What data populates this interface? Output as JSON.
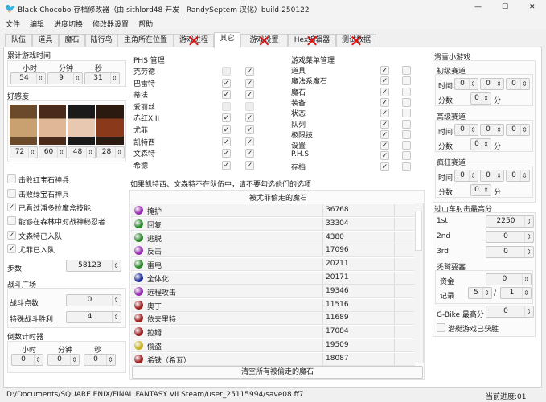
{
  "window": {
    "title": "Black Chocobo 存档修改器（由 sithlord48 开发 | RandySeptem 汉化）build-250122",
    "controls": [
      "—",
      "☐",
      "✕"
    ]
  },
  "menu": [
    "文件",
    "编辑",
    "进度切换",
    "修改器设置",
    "帮助"
  ],
  "tabs": [
    {
      "label": "队伍"
    },
    {
      "label": "道具"
    },
    {
      "label": "魔石"
    },
    {
      "label": "陆行鸟"
    },
    {
      "label": "主角所在位置"
    },
    {
      "label": "游戏进程",
      "crossed": true
    },
    {
      "label": "其它",
      "selected": true
    },
    {
      "label": "游戏设置",
      "crossed": true
    },
    {
      "label": "Hex编辑器",
      "crossed": true
    },
    {
      "label": "测试数据",
      "crossed": true
    }
  ],
  "left": {
    "playtime": {
      "title": "累计游戏时间",
      "labels": [
        "小时",
        "分钟",
        "秒"
      ],
      "values": [
        "54",
        "9",
        "31"
      ]
    },
    "love": {
      "title": "好感度",
      "values": [
        "72",
        "60",
        "48",
        "28"
      ]
    },
    "flags": [
      {
        "label": "击败红宝石神兵",
        "checked": false
      },
      {
        "label": "击败绿宝石神兵",
        "checked": false
      },
      {
        "label": "已看过潘多拉魔盒技能",
        "checked": true
      },
      {
        "label": "能够在森林中对战神秘忍者",
        "checked": false
      },
      {
        "label": "文森特已入队",
        "checked": true
      },
      {
        "label": "尤菲已入队",
        "checked": true
      }
    ],
    "steps": {
      "label": "步数",
      "value": "58123"
    },
    "battle_square": {
      "title": "战斗广场",
      "points_label": "战斗点数",
      "points": "0",
      "special_label": "特殊战斗胜利",
      "special": "4"
    },
    "countdown": {
      "title": "倒数计时器",
      "labels": [
        "小时",
        "分钟",
        "秒"
      ],
      "values": [
        "0",
        "0",
        "0"
      ]
    }
  },
  "phs": {
    "title": "PHS 管理",
    "rows": [
      {
        "name": "克劳德",
        "a": false,
        "a_disabled": true,
        "b": true
      },
      {
        "name": "巴雷特",
        "a": true,
        "b": true
      },
      {
        "name": "蒂法",
        "a": true,
        "b": true
      },
      {
        "name": "爱丽丝",
        "a": false,
        "a_disabled": true,
        "b": false,
        "b_disabled": true
      },
      {
        "name": "赤红XIII",
        "a": true,
        "b": true
      },
      {
        "name": "尤菲",
        "a": true,
        "b": true
      },
      {
        "name": "凯特西",
        "a": true,
        "b": true
      },
      {
        "name": "文森特",
        "a": true,
        "b": true
      },
      {
        "name": "希德",
        "a": true,
        "b": true
      }
    ]
  },
  "game_menu": {
    "title": "游戏菜单管理",
    "rows": [
      {
        "name": "道具",
        "a": true,
        "b": false
      },
      {
        "name": "魔法系魔石",
        "a": true,
        "b": false
      },
      {
        "name": "魔石",
        "a": true,
        "b": false
      },
      {
        "name": "装备",
        "a": true,
        "b": false
      },
      {
        "name": "状态",
        "a": true,
        "b": false
      },
      {
        "name": "队列",
        "a": true,
        "b": false
      },
      {
        "name": "极限技",
        "a": true,
        "b": false
      },
      {
        "name": "设置",
        "a": true,
        "b": false
      },
      {
        "name": "P.H.S",
        "a": true,
        "b": false
      },
      {
        "name": "存档",
        "a": true,
        "b": false
      }
    ]
  },
  "note": "如果凯特西、文森特不在队伍中，请不要勾选他们的选项",
  "stolen": {
    "title": "被尤菲偷走的魔石",
    "clear_label": "清空所有被偷走的魔石",
    "rows": [
      {
        "name": "掩护",
        "value": "36768",
        "color": "#9a2db5"
      },
      {
        "name": "回复",
        "value": "33304",
        "color": "#2a8a2a"
      },
      {
        "name": "逃脱",
        "value": "4380",
        "color": "#2a8a2a"
      },
      {
        "name": "反击",
        "value": "17096",
        "color": "#9a2db5"
      },
      {
        "name": "雷电",
        "value": "20211",
        "color": "#2a8a2a"
      },
      {
        "name": "全体化",
        "value": "20171",
        "color": "#1c2a9a"
      },
      {
        "name": "远程攻击",
        "value": "19346",
        "color": "#9a2db5"
      },
      {
        "name": "奥丁",
        "value": "11516",
        "color": "#a02020"
      },
      {
        "name": "依夫里特",
        "value": "11689",
        "color": "#a02020"
      },
      {
        "name": "拉姆",
        "value": "17084",
        "color": "#a02020"
      },
      {
        "name": "偷盗",
        "value": "19509",
        "color": "#c9b020"
      },
      {
        "name": "希铁（希瓦）",
        "value": "18087",
        "color": "#a02020"
      }
    ]
  },
  "right": {
    "snowboard": {
      "title": "滑雪小游戏",
      "time_label": "时间:",
      "score_label": "分数:",
      "unit": "分",
      "courses": [
        {
          "title": "初级赛道",
          "time": [
            "0",
            "0",
            "0"
          ],
          "score": "0"
        },
        {
          "title": "高级赛道",
          "time": [
            "0",
            "0",
            "0"
          ],
          "score": "0"
        },
        {
          "title": "疯狂赛道",
          "time": [
            "0",
            "0",
            "0"
          ],
          "score": "0"
        }
      ]
    },
    "coaster": {
      "title": "过山车射击最高分",
      "scores": [
        {
          "label": "1st",
          "value": "2250"
        },
        {
          "label": "2nd",
          "value": "0"
        },
        {
          "label": "3rd",
          "value": "0"
        }
      ]
    },
    "fort": {
      "title": "秃鹫要塞",
      "funds_label": "资金",
      "funds": "0",
      "record_label": "记录",
      "record_a": "5",
      "sep": "/",
      "record_b": "1"
    },
    "gbike": {
      "label": "G-Bike 最高分",
      "value": "0"
    },
    "sub": {
      "label": "潜艇游戏已获胜",
      "checked": false
    }
  },
  "status": {
    "path": "D:/Documents/SQUARE ENIX/FINAL FANTASY VII Steam/user_25115994/save08.ff7",
    "progress": "当前进度:01"
  }
}
